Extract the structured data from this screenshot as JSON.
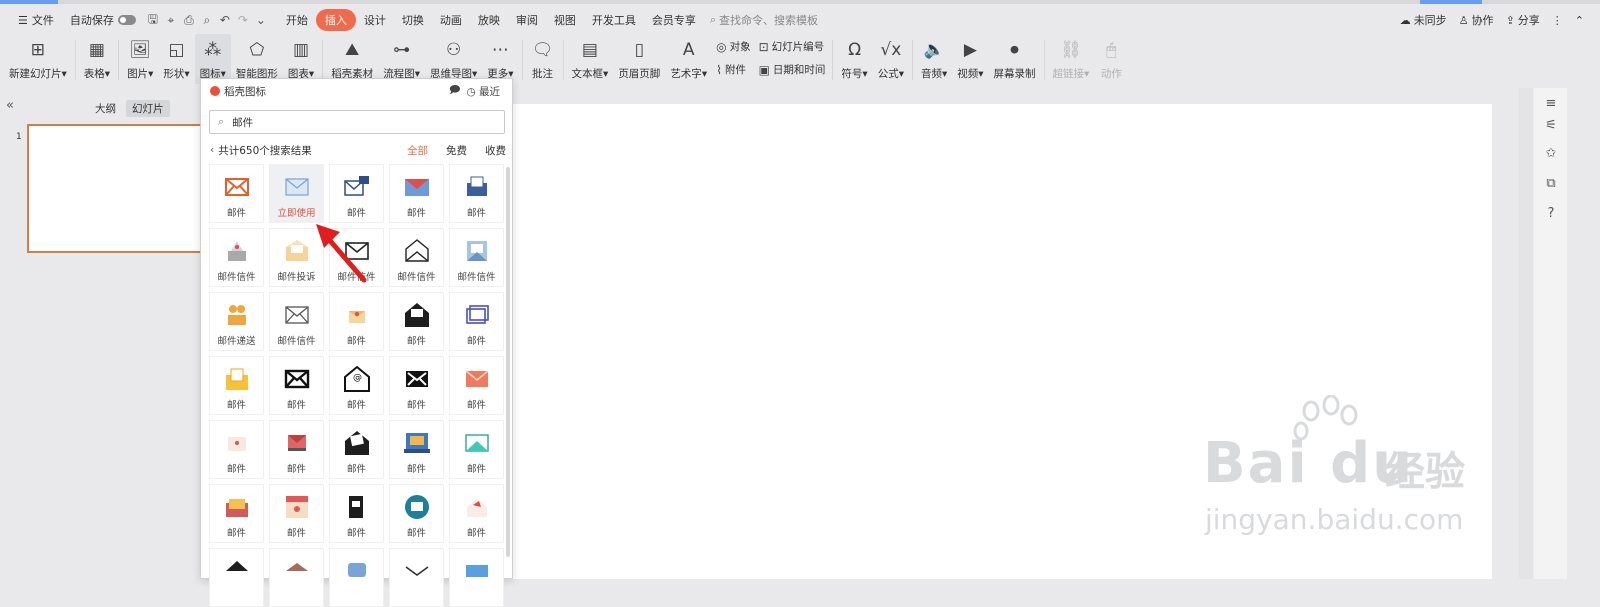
{
  "menu": {
    "hamburger_icon": "menu-icon",
    "file": "文件",
    "autosave": "自动保存",
    "tabs": [
      "开始",
      "插入",
      "设计",
      "切换",
      "动画",
      "放映",
      "审阅",
      "视图",
      "开发工具",
      "会员专享"
    ],
    "active_tab": "插入",
    "search_placeholder": "查找命令、搜索模板",
    "right": {
      "sync": "未同步",
      "collab": "协作",
      "share": "分享"
    }
  },
  "ribbon": {
    "new_slide": "新建幻灯片",
    "table": "表格",
    "picture": "图片",
    "shape": "形状",
    "icon": "图标",
    "smart_graphic": "智能图形",
    "chart": "图表",
    "daoke_material": "稻壳素材",
    "flowchart": "流程图",
    "mindmap": "思维导图",
    "more": "更多",
    "comment": "批注",
    "textbox": "文本框",
    "header_footer": "页眉页脚",
    "wordart": "艺术字",
    "object": "对象",
    "attachment": "附件",
    "slide_number": "幻灯片编号",
    "datetime": "日期和时间",
    "symbol": "符号",
    "formula": "公式",
    "audio": "音频",
    "video": "视频",
    "screen_record": "屏幕录制",
    "hyperlink": "超链接",
    "action": "动作"
  },
  "left_panel": {
    "tab_outline": "大纲",
    "tab_slides": "幻灯片",
    "slide_number": "1"
  },
  "icon_panel": {
    "title": "稻壳图标",
    "recent": "最近",
    "search_value": "邮件",
    "result_count": "共计650个搜索结果",
    "filters": [
      "全部",
      "免费",
      "收费"
    ],
    "active_filter": "全部",
    "use_now": "立即使用",
    "items": [
      "邮件",
      "",
      "邮件",
      "邮件",
      "邮件",
      "邮件信件",
      "邮件投诉",
      "邮件信件",
      "邮件信件",
      "邮件信件",
      "邮件递送",
      "邮件信件",
      "邮件",
      "邮件",
      "邮件",
      "邮件",
      "邮件",
      "邮件",
      "邮件",
      "邮件",
      "邮件",
      "邮件",
      "邮件",
      "邮件",
      "邮件",
      "邮件",
      "邮件",
      "邮件",
      "邮件",
      "邮件",
      "",
      "",
      "",
      "",
      ""
    ]
  },
  "watermark": {
    "brand": "Bai du",
    "suffix": "经验",
    "url": "jingyan.baidu.com"
  },
  "colors": {
    "accent": "#ee6b4d",
    "thumb_border": "#d27d45",
    "arrow": "#e01e1e"
  }
}
